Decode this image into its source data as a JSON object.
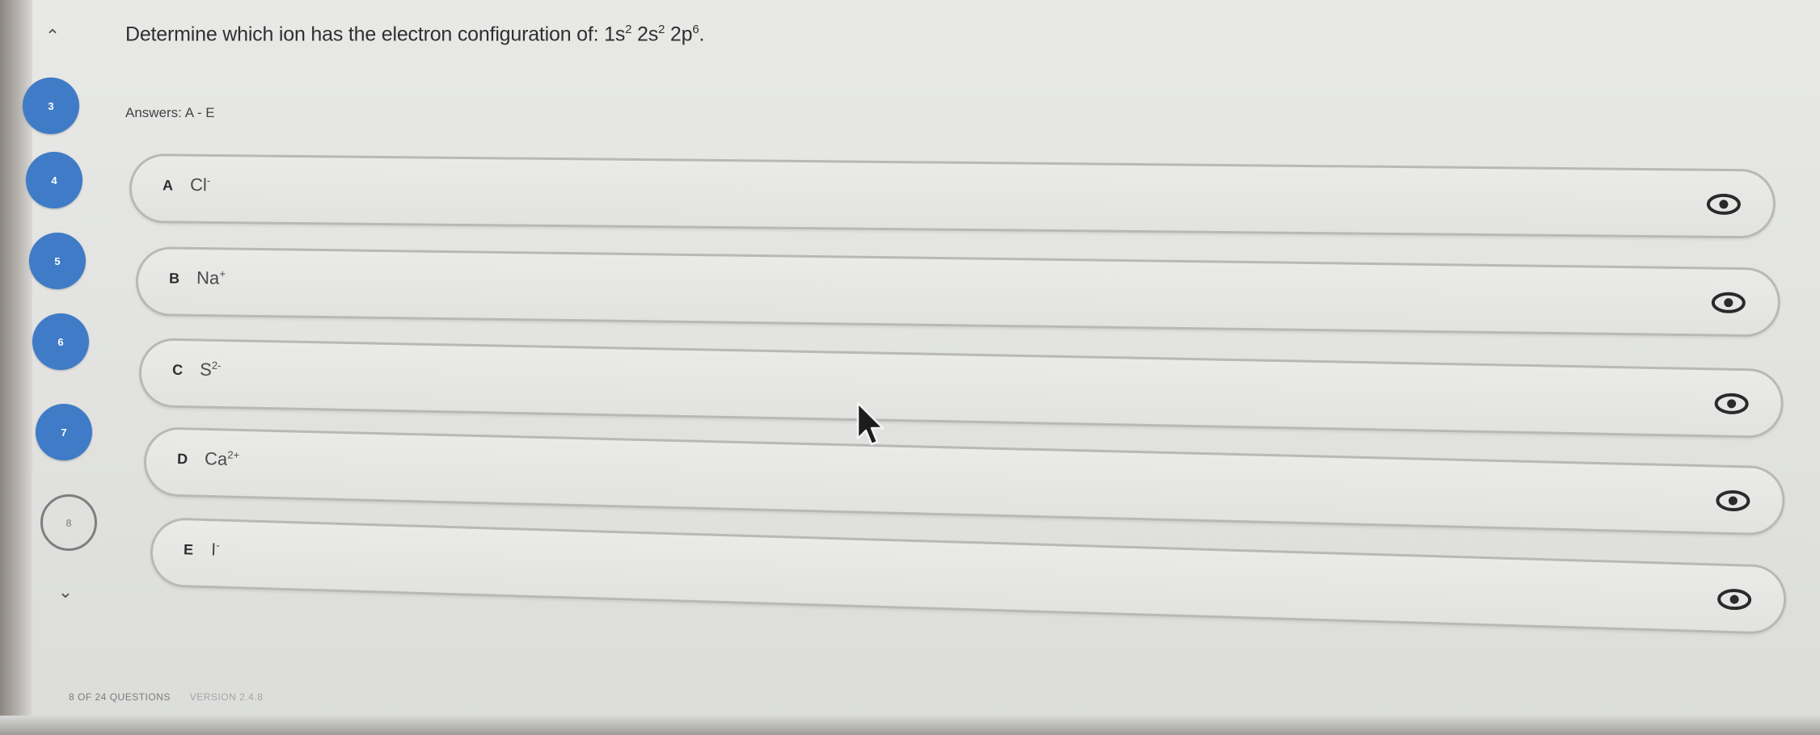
{
  "question": {
    "prefix": "Determine which ion has the electron configuration of: 1s",
    "sup1": "2",
    "mid1": " 2s",
    "sup2": "2",
    "mid2": " 2p",
    "sup3": "6",
    "suffix": "."
  },
  "answers_range": "Answers: A - E",
  "navigator": {
    "up_icon": "chevron-up-icon",
    "down_icon": "chevron-down-icon",
    "items": [
      {
        "label": "3",
        "state": "answered"
      },
      {
        "label": "4",
        "state": "answered"
      },
      {
        "label": "5",
        "state": "answered"
      },
      {
        "label": "6",
        "state": "answered"
      },
      {
        "label": "7",
        "state": "answered"
      },
      {
        "label": "8",
        "state": "current"
      }
    ]
  },
  "options": [
    {
      "letter": "A",
      "base": "Cl",
      "sup": "-"
    },
    {
      "letter": "B",
      "base": "Na",
      "sup": "+"
    },
    {
      "letter": "C",
      "base": "S",
      "sup": "2-"
    },
    {
      "letter": "D",
      "base": "Ca",
      "sup": "2+"
    },
    {
      "letter": "E",
      "base": "I",
      "sup": "-"
    }
  ],
  "footer": {
    "progress": "8 OF 24 QUESTIONS",
    "version": "VERSION 2.4.8"
  },
  "colors": {
    "nav_accent": "#3f7bc7",
    "option_border": "#b8b9b7",
    "eye_icon": "#2a2a2a"
  },
  "icons": {
    "eye": "eye-icon",
    "cursor": "mouse-pointer-icon"
  }
}
